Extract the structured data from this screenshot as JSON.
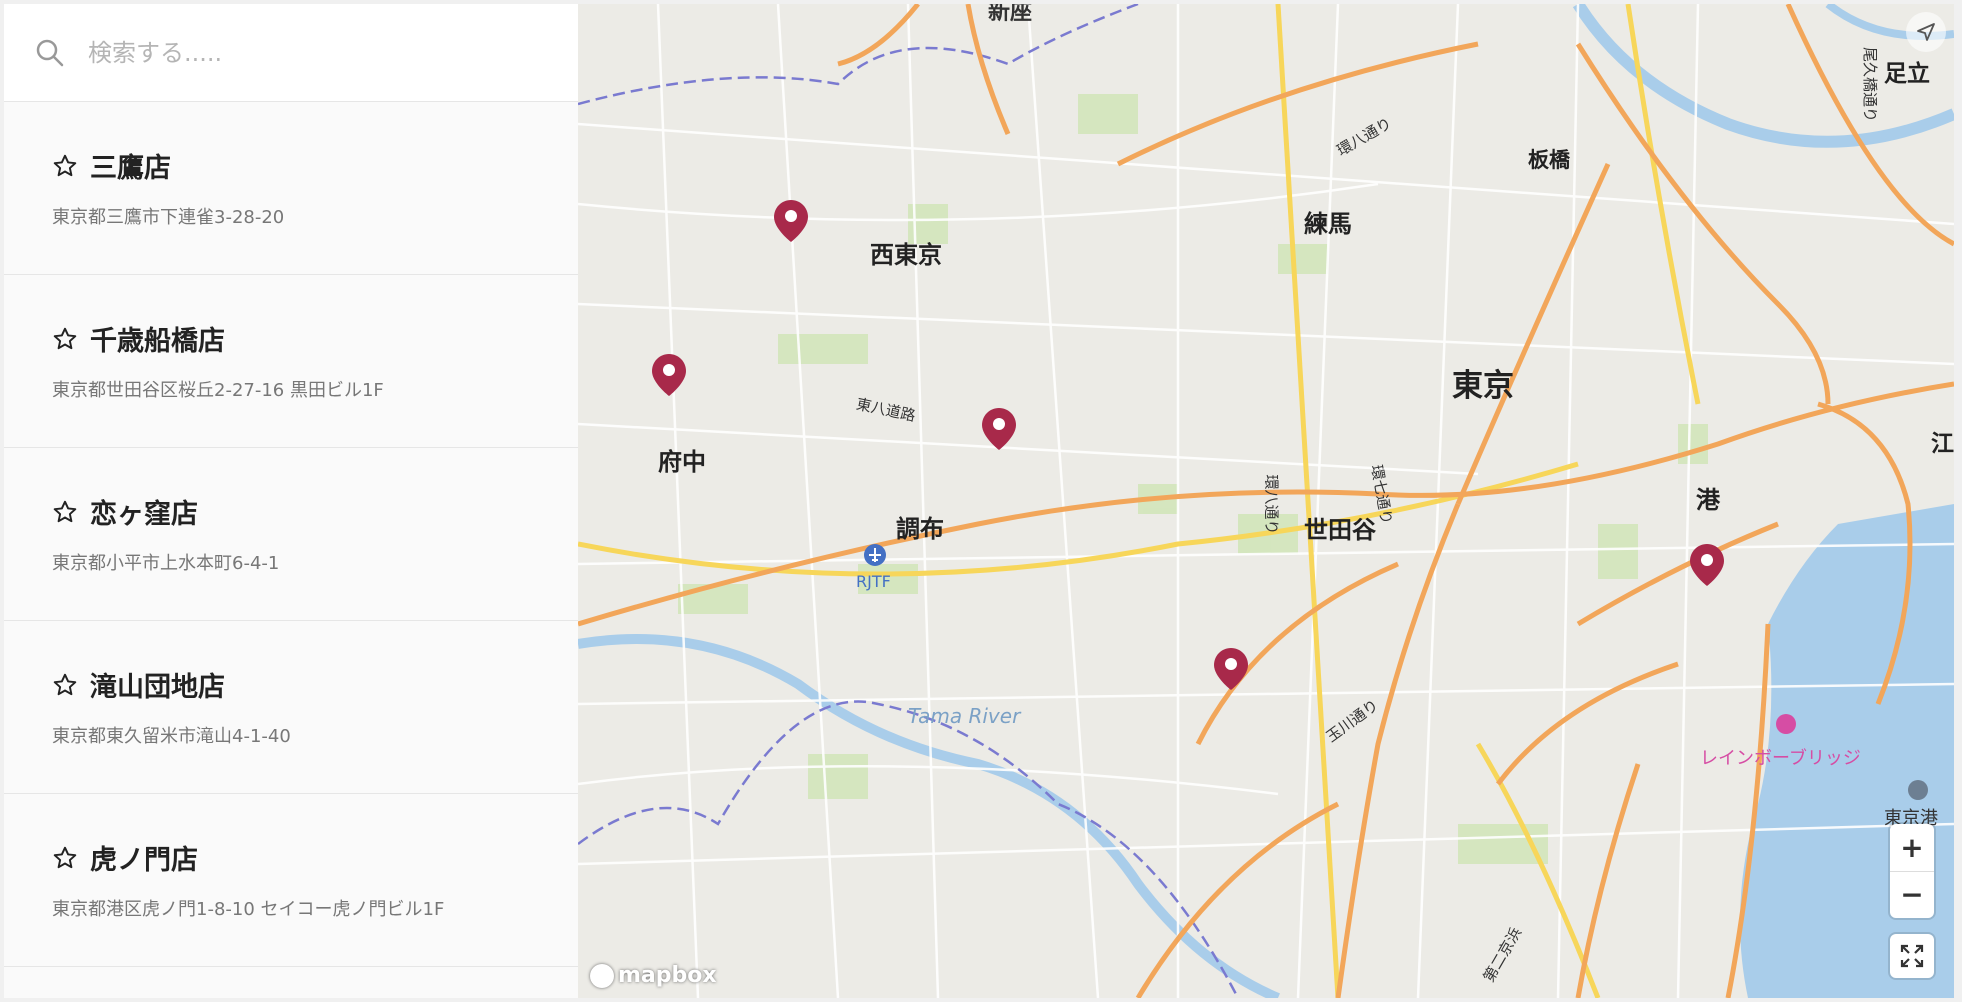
{
  "search": {
    "placeholder": "検索する....."
  },
  "stores": [
    {
      "name": "三鷹店",
      "address": "東京都三鷹市下連雀3-28-20"
    },
    {
      "name": "千歳船橋店",
      "address": "東京都世田谷区桜丘2-27-16 黒田ビル1F"
    },
    {
      "name": "恋ヶ窪店",
      "address": "東京都小平市上水本町6-4-1"
    },
    {
      "name": "滝山団地店",
      "address": "東京都東久留米市滝山4-1-40"
    },
    {
      "name": "虎ノ門店",
      "address": "東京都港区虎ノ門1-8-10 セイコー虎ノ門ビル1F"
    }
  ],
  "map": {
    "labels": {
      "nishitokyo": "西東京",
      "nerima": "練馬",
      "tokyo": "東京",
      "fuchu": "府中",
      "chofu": "調布",
      "setagaya": "世田谷",
      "minato": "港",
      "itabashi": "板橋",
      "adachi": "足立",
      "ko": "江",
      "shinza": "新座",
      "kanpachi1": "環八通り",
      "kanpachi2": "環八通り",
      "kannana": "環七通り",
      "higashihachi": "東八道路",
      "tamagawa": "玉川通り",
      "dainikeihin": "第二京浜",
      "oku": "尾久橋通り",
      "tama_river": "Tama River",
      "rjtf": "RJTF",
      "rainbow": "レインボーブリッジ",
      "tokyo_port": "東京港"
    },
    "logo": "mapbox",
    "zoom_in": "+",
    "zoom_out": "−",
    "pin_color": "#a8294a"
  }
}
